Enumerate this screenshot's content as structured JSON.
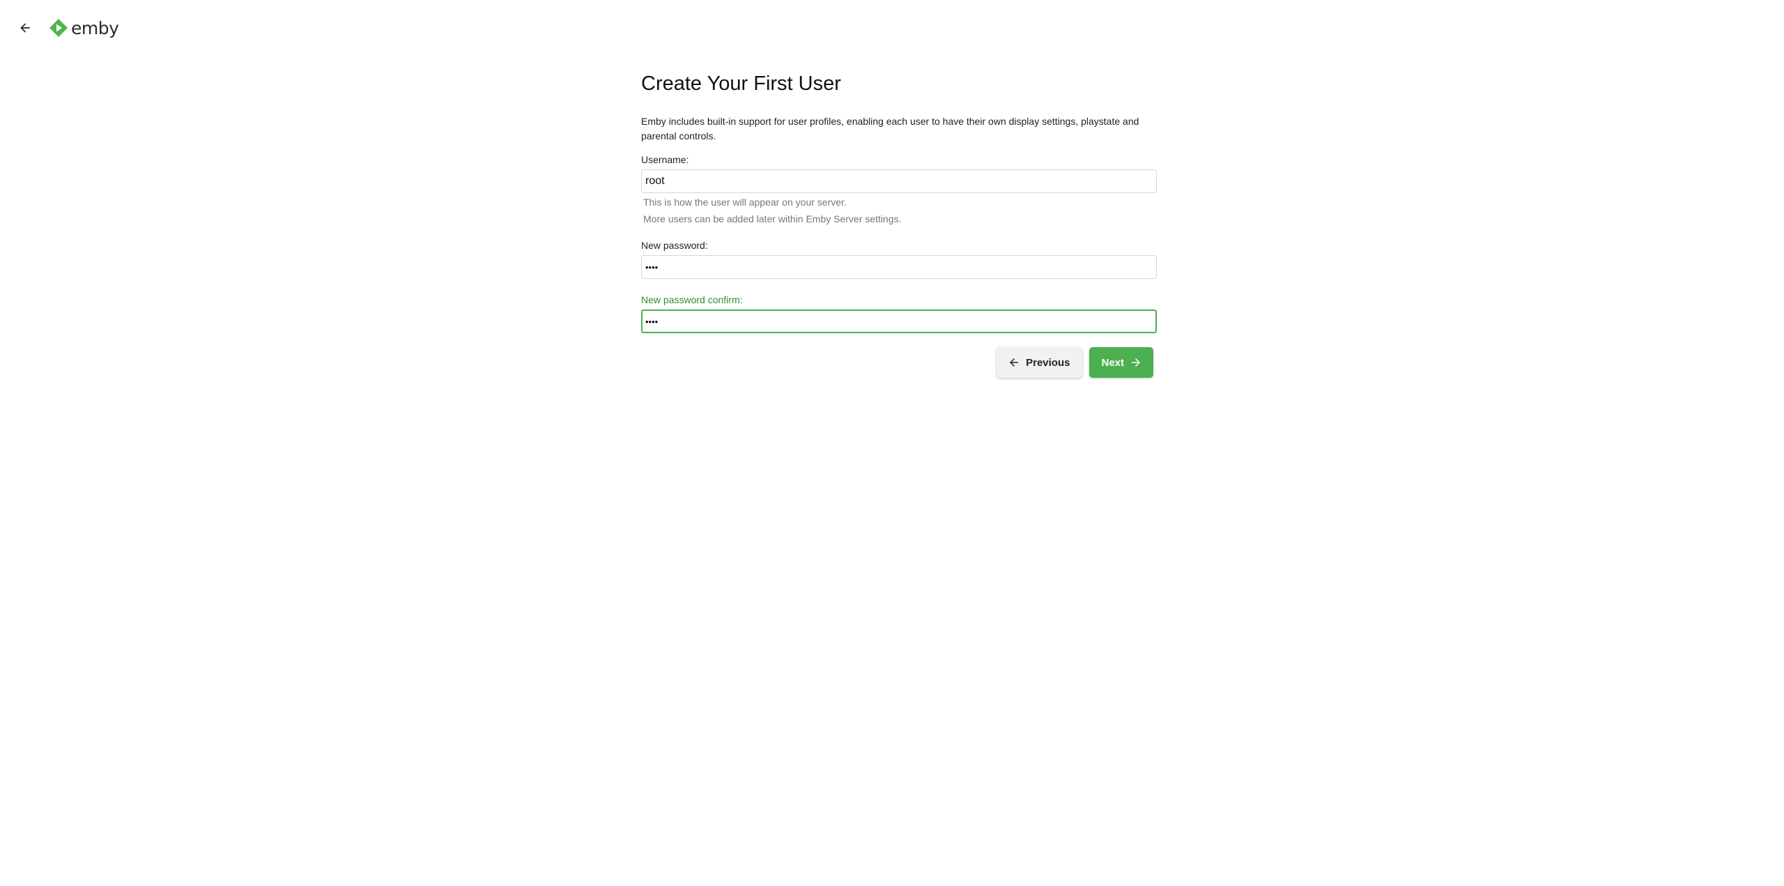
{
  "header": {
    "back_icon": "arrow-left-icon",
    "logo_icon": "emby-play-icon",
    "logo_text": "emby",
    "brand_color": "#52b54b"
  },
  "page": {
    "title": "Create Your First User",
    "intro": "Emby includes built-in support for user profiles, enabling each user to have their own display settings, playstate and parental controls."
  },
  "form": {
    "username": {
      "label": "Username:",
      "value": "root",
      "help": [
        "This is how the user will appear on your server.",
        "More users can be added later within Emby Server settings."
      ]
    },
    "password": {
      "label": "New password:",
      "value": "••••"
    },
    "password_confirm": {
      "label": "New password confirm:",
      "value": "••••",
      "focused": true
    }
  },
  "buttons": {
    "previous": {
      "label": "Previous",
      "icon": "arrow-left-icon"
    },
    "next": {
      "label": "Next",
      "icon": "arrow-right-icon"
    }
  },
  "colors": {
    "accent": "#4caf50",
    "focus_label": "#2e8b2e",
    "help_text": "#777777"
  }
}
